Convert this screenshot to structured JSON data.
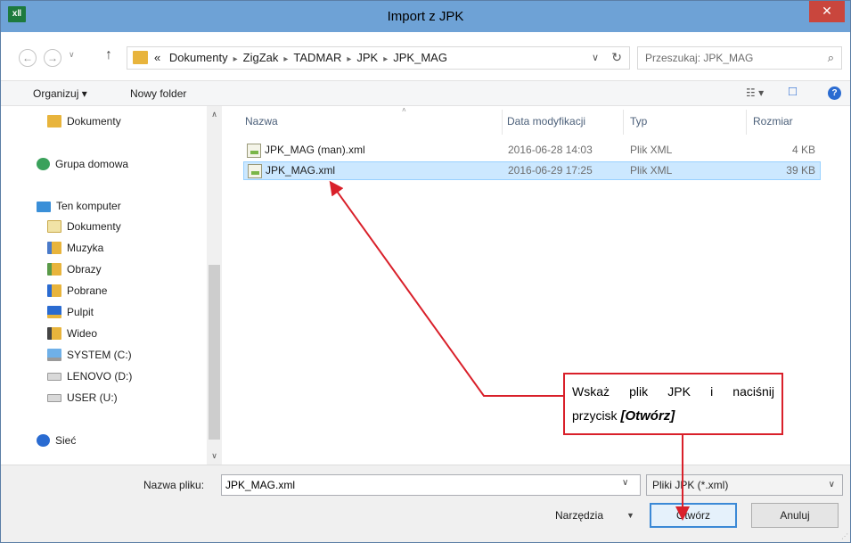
{
  "window": {
    "app_icon": "x‖",
    "title": "Import z JPK",
    "close": "✕"
  },
  "address": {
    "back": "←",
    "forward": "→",
    "recent": "∨",
    "up": "↑",
    "overflow": "«",
    "crumbs": [
      "Dokumenty",
      "ZigZak",
      "TADMAR",
      "JPK",
      "JPK_MAG"
    ],
    "sep": "▸",
    "dropdown": "∨",
    "refresh": "↻",
    "search_placeholder": "Przeszukaj: JPK_MAG",
    "search_icon": "⌕"
  },
  "toolbar": {
    "organize": "Organizuj ▾",
    "new_folder": "Nowy folder",
    "view_icon": "☷ ▾",
    "pane_icon": "□",
    "help_icon": "?"
  },
  "nav": {
    "items": [
      {
        "label": "Dokumenty"
      },
      {
        "label": "Grupa domowa"
      },
      {
        "label": "Ten komputer"
      },
      {
        "label": "Dokumenty"
      },
      {
        "label": "Muzyka"
      },
      {
        "label": "Obrazy"
      },
      {
        "label": "Pobrane"
      },
      {
        "label": "Pulpit"
      },
      {
        "label": "Wideo"
      },
      {
        "label": "SYSTEM (C:)"
      },
      {
        "label": "LENOVO (D:)"
      },
      {
        "label": "USER (U:)"
      },
      {
        "label": "Sieć"
      }
    ],
    "scroll_up": "∧",
    "scroll_down": "∨"
  },
  "columns": {
    "name": "Nazwa",
    "modified": "Data modyfikacji",
    "type": "Typ",
    "size": "Rozmiar",
    "sort": "˄"
  },
  "files": [
    {
      "name": "JPK_MAG (man).xml",
      "modified": "2016-06-28 14:03",
      "type": "Plik XML",
      "size": "4 KB"
    },
    {
      "name": "JPK_MAG.xml",
      "modified": "2016-06-29 17:25",
      "type": "Plik XML",
      "size": "39 KB"
    }
  ],
  "bottom": {
    "filename_label": "Nazwa pliku:",
    "filename_value": "JPK_MAG.xml",
    "filename_drop": "∨",
    "filetype": "Pliki JPK (*.xml)",
    "filetype_drop": "∨",
    "tools": "Narzędzia",
    "tools_drop": "▼",
    "open": "Otwórz",
    "cancel": "Anuluj"
  },
  "callout": {
    "line1": "Wskaż plik JPK i naciśnij",
    "line2_prefix": "przycisk ",
    "line2_emph": "[Otwórz]"
  },
  "colors": {
    "annotation": "#d9202a",
    "selection": "#cce8ff",
    "titlebar": "#6ea2d6"
  }
}
